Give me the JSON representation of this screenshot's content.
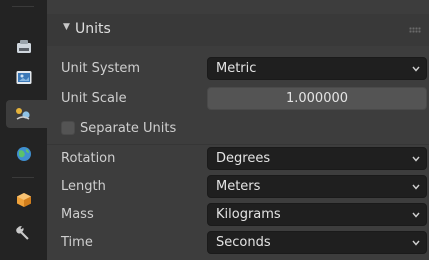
{
  "panel": {
    "title": "Units"
  },
  "rows": {
    "unit_system": {
      "label": "Unit System",
      "value": "Metric"
    },
    "unit_scale": {
      "label": "Unit Scale",
      "value": "1.000000"
    },
    "separate_units": {
      "label": "Separate Units",
      "checked": false
    },
    "rotation": {
      "label": "Rotation",
      "value": "Degrees"
    },
    "length": {
      "label": "Length",
      "value": "Meters"
    },
    "mass": {
      "label": "Mass",
      "value": "Kilograms"
    },
    "time": {
      "label": "Time",
      "value": "Seconds"
    }
  },
  "tabs": [
    {
      "icon": "render-icon"
    },
    {
      "icon": "output-icon"
    },
    {
      "icon": "view-layer-icon"
    },
    {
      "icon": "scene-icon"
    },
    {
      "icon": "world-icon"
    },
    {
      "icon": "object-icon"
    },
    {
      "icon": "modifier-wrench-icon"
    }
  ],
  "colors": {
    "panel_bg": "#3d3d3d",
    "tab_strip_bg": "#232323",
    "dropdown_bg": "#1f1f1f",
    "number_field_bg": "#545454"
  }
}
